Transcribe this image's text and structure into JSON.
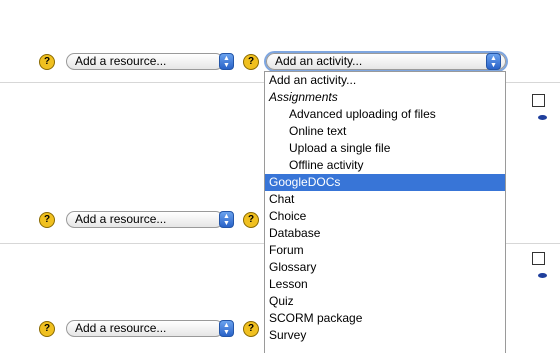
{
  "help_glyph": "?",
  "stepper_glyph": {
    "up": "▲",
    "down": "▼"
  },
  "sections": [
    {
      "resource_select": "Add a resource...",
      "activity_select": "Add an activity..."
    },
    {
      "resource_select": "Add a resource..."
    },
    {
      "resource_select": "Add a resource..."
    }
  ],
  "activity_dropdown": {
    "options": [
      {
        "label": "Add an activity...",
        "kind": "option"
      },
      {
        "label": "Assignments",
        "kind": "group"
      },
      {
        "label": "Advanced uploading of files",
        "kind": "sub"
      },
      {
        "label": "Online text",
        "kind": "sub"
      },
      {
        "label": "Upload a single file",
        "kind": "sub"
      },
      {
        "label": "Offline activity",
        "kind": "sub"
      },
      {
        "label": "GoogleDOCs",
        "kind": "selected"
      },
      {
        "label": "Chat",
        "kind": "option"
      },
      {
        "label": "Choice",
        "kind": "option"
      },
      {
        "label": "Database",
        "kind": "option"
      },
      {
        "label": "Forum",
        "kind": "option"
      },
      {
        "label": "Glossary",
        "kind": "option"
      },
      {
        "label": "Lesson",
        "kind": "option"
      },
      {
        "label": "Quiz",
        "kind": "option"
      },
      {
        "label": "SCORM package",
        "kind": "option"
      },
      {
        "label": "Survey",
        "kind": "option"
      }
    ]
  },
  "colors": {
    "highlight": "#3875d7",
    "help_icon": "#f0c020",
    "stepper": "#2a63c8",
    "eye_icon": "#1f3f9c"
  }
}
